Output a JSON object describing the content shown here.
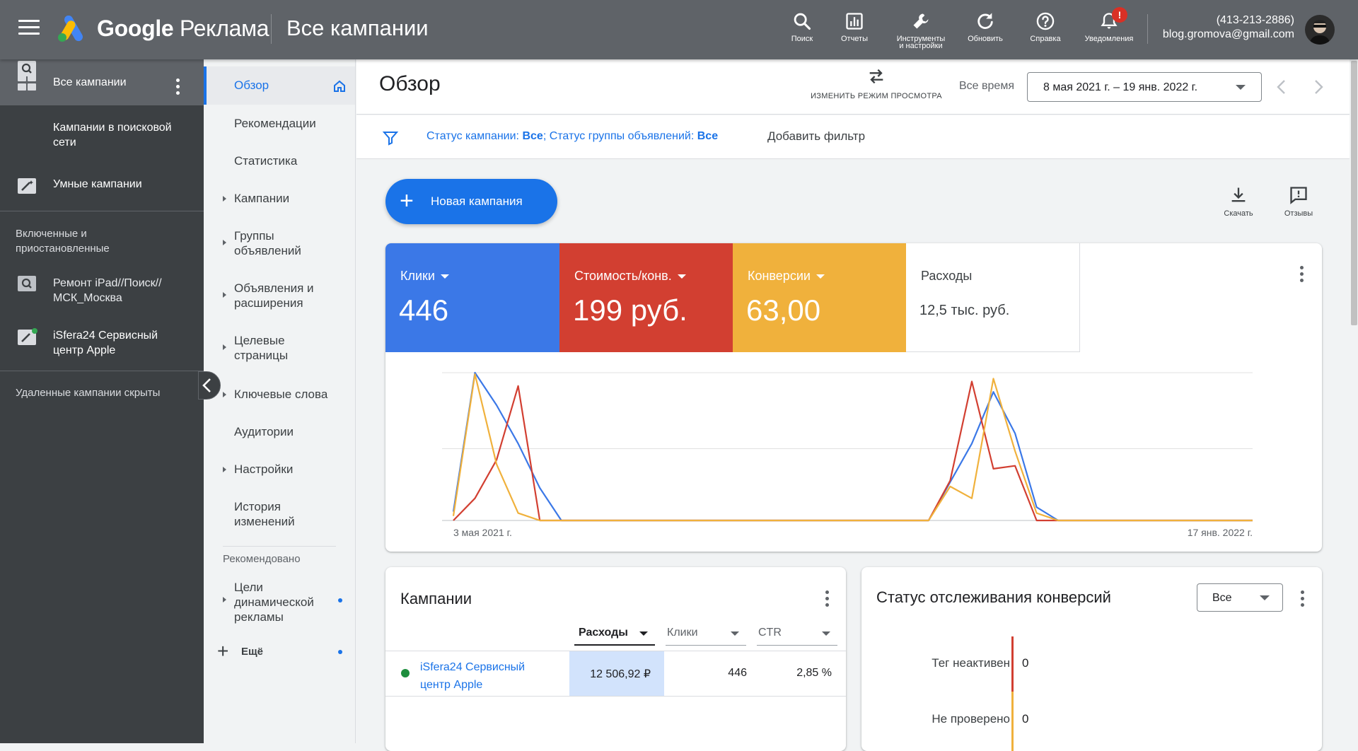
{
  "topbar": {
    "brand_google": "Google",
    "brand_ads": "Реклама",
    "section_title": "Все кампании",
    "buttons": [
      {
        "label": "Поиск",
        "icon": "search-icon"
      },
      {
        "label": "Отчеты",
        "icon": "reports-icon"
      },
      {
        "label": "Инструменты и настройки",
        "icon": "wrench-icon"
      },
      {
        "label": "Обновить",
        "icon": "refresh-icon"
      },
      {
        "label": "Справка",
        "icon": "help-icon"
      },
      {
        "label": "Уведомления",
        "icon": "bell-icon",
        "badge": "!"
      }
    ],
    "phone": "(413-213-2886)",
    "email": "blog.gromova@gmail.com"
  },
  "leftnav": {
    "top_item": "Все кампании",
    "items": [
      {
        "label_1": "Кампании в поисковой",
        "label_2": "сети",
        "icon": "search-campaign-icon"
      },
      {
        "label_1": "Умные кампании",
        "icon": "smart-campaign-icon"
      }
    ],
    "group_heading_1": "Включенные и",
    "group_heading_2": "приостановленные",
    "campaigns": [
      {
        "label_1": "Ремонт iPad//Поиск//",
        "label_2": "МСК_Москва",
        "icon": "search-campaign-icon"
      },
      {
        "label_1": "iSfera24 Сервисный",
        "label_2": "центр Apple",
        "icon": "smart-campaign-icon"
      }
    ],
    "removed_hidden": "Удаленные кампании скрыты"
  },
  "subnav": {
    "items": [
      {
        "label_1": "Обзор"
      },
      {
        "label_1": "Рекомендации"
      },
      {
        "label_1": "Статистика"
      },
      {
        "label_1": "Кампании"
      },
      {
        "label_1": "Группы",
        "label_2": "объявлений"
      },
      {
        "label_1": "Объявления и",
        "label_2": "расширения"
      },
      {
        "label_1": "Целевые",
        "label_2": "страницы"
      },
      {
        "label_1": "Ключевые слова"
      },
      {
        "label_1": "Аудитории"
      },
      {
        "label_1": "Настройки"
      },
      {
        "label_1": "История",
        "label_2": "изменений"
      }
    ],
    "recommended_heading": "Рекомендовано",
    "dynamic_goals_1": "Цели",
    "dynamic_goals_2": "динамической",
    "dynamic_goals_3": "рекламы",
    "more": "Ещё"
  },
  "header": {
    "title": "Обзор",
    "view_mode_label": "ИЗМЕНИТЬ РЕЖИМ ПРОСМОТРА",
    "all_time": "Все время",
    "date_range": "8 мая 2021 г. – 19 янв. 2022 г."
  },
  "filters": {
    "campaign_status_label": "Статус кампании:",
    "campaign_status_value": "Все",
    "group_status_label": "Статус группы объявлений:",
    "group_status_value": "Все",
    "separator": ";",
    "add_filter": "Добавить фильтр"
  },
  "actions": {
    "new_campaign": "Новая кампания",
    "download": "Скачать",
    "feedback": "Отзывы"
  },
  "metrics": [
    {
      "name": "Клики",
      "value": "446",
      "color": "#3b78e7"
    },
    {
      "name": "Стоимость/конв.",
      "value": "199 руб.",
      "color": "#d23f31"
    },
    {
      "name": "Конверсии",
      "value": "63,00",
      "color": "#f0b13c"
    },
    {
      "name": "Расходы",
      "value": "12,5 тыс. руб.",
      "color": "#ffffff"
    }
  ],
  "chart_data": {
    "type": "line",
    "x_start_label": "3 мая 2021 г.",
    "x_end_label": "17 янв. 2022 г.",
    "ylim": [
      0,
      1
    ],
    "grid": true,
    "point_count": 38,
    "series": [
      {
        "metric": "Клики",
        "color": "#3b78e7",
        "values": [
          0.06,
          1.0,
          0.78,
          0.52,
          0.22,
          0,
          0,
          0,
          0,
          0,
          0,
          0,
          0,
          0,
          0,
          0,
          0,
          0,
          0,
          0,
          0,
          0,
          0,
          0.26,
          0.52,
          0.87,
          0.59,
          0.09,
          0,
          0,
          0,
          0,
          0,
          0,
          0,
          0,
          0,
          0
        ]
      },
      {
        "metric": "Стоимость/конв.",
        "color": "#d23f31",
        "values": [
          0,
          0.15,
          0.41,
          0.91,
          0,
          0,
          0,
          0,
          0,
          0,
          0,
          0,
          0,
          0,
          0,
          0,
          0,
          0,
          0,
          0,
          0,
          0,
          0,
          0.27,
          0.94,
          0.35,
          0.37,
          0,
          0,
          0,
          0,
          0,
          0,
          0,
          0,
          0,
          0,
          0
        ]
      },
      {
        "metric": "Конверсии",
        "color": "#f0b13c",
        "values": [
          0.03,
          0.99,
          0.38,
          0.05,
          0,
          0,
          0,
          0,
          0,
          0,
          0,
          0,
          0,
          0,
          0,
          0,
          0,
          0,
          0,
          0,
          0,
          0,
          0,
          0.23,
          0.15,
          0.96,
          0.47,
          0.05,
          0,
          0,
          0,
          0,
          0,
          0,
          0,
          0,
          0,
          0
        ]
      }
    ]
  },
  "campaigns_card": {
    "title": "Кампании",
    "columns": [
      "Расходы",
      "Клики",
      "CTR"
    ],
    "rows": [
      {
        "name_1": "iSfera24 Сервисный",
        "name_2": "центр Apple",
        "status_color": "#1e8e3e",
        "cost": "12 506,92 ₽",
        "clicks": "446",
        "ctr": "2,85 %"
      }
    ]
  },
  "conversion_card": {
    "title": "Статус отслеживания конверсий",
    "select_value": "Все",
    "rows": [
      {
        "label": "Тег неактивен",
        "value": "0",
        "color": "#d23f31"
      },
      {
        "label": "Не проверено",
        "value": "0",
        "color": "#f0b13c"
      }
    ]
  }
}
